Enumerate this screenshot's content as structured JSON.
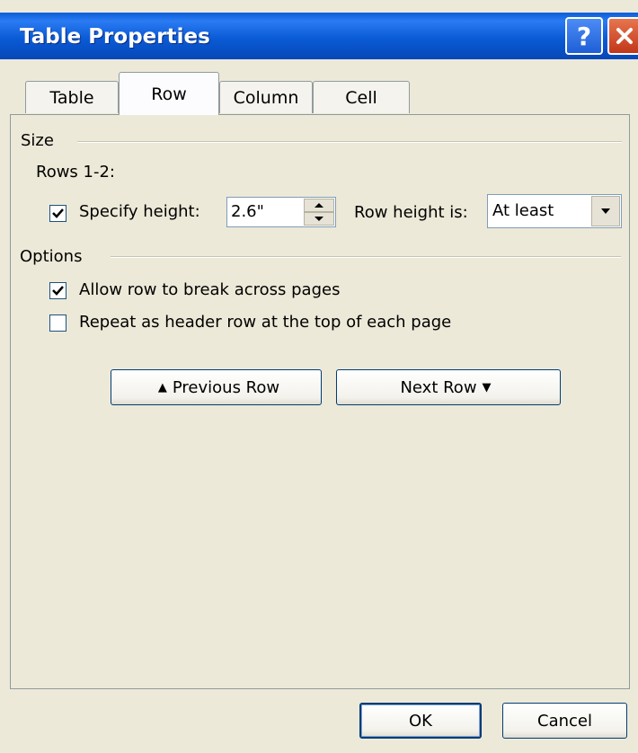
{
  "window": {
    "title": "Table Properties",
    "help_glyph": "?",
    "close_glyph": "✕"
  },
  "tabs": [
    {
      "label": "Table",
      "mnemonic_index": 0
    },
    {
      "label": "Row",
      "mnemonic_index": 0,
      "active": true
    },
    {
      "label": "Column",
      "mnemonic_index": 3
    },
    {
      "label": "Cell",
      "mnemonic_index": 1
    }
  ],
  "size_group": {
    "label": "Size",
    "rows_label": "Rows 1-2:",
    "specify_height": {
      "label": "Specify height:",
      "checked": true
    },
    "height_value": "2.6\"",
    "row_height_is_label": "Row height is:",
    "row_height_is_value": "At least"
  },
  "options_group": {
    "label": "Options",
    "allow_break": {
      "label": "Allow row to break across pages",
      "checked": true
    },
    "repeat_header": {
      "label": "Repeat as header row at the top of each page",
      "checked": false
    }
  },
  "nav": {
    "previous_label": "Previous Row",
    "next_label": "Next Row"
  },
  "footer": {
    "ok_label": "OK",
    "cancel_label": "Cancel"
  },
  "colors": {
    "dialog_bg": "#ECE9D8",
    "titlebar_blue": "#0A5BD6",
    "close_red": "#C2361A"
  }
}
